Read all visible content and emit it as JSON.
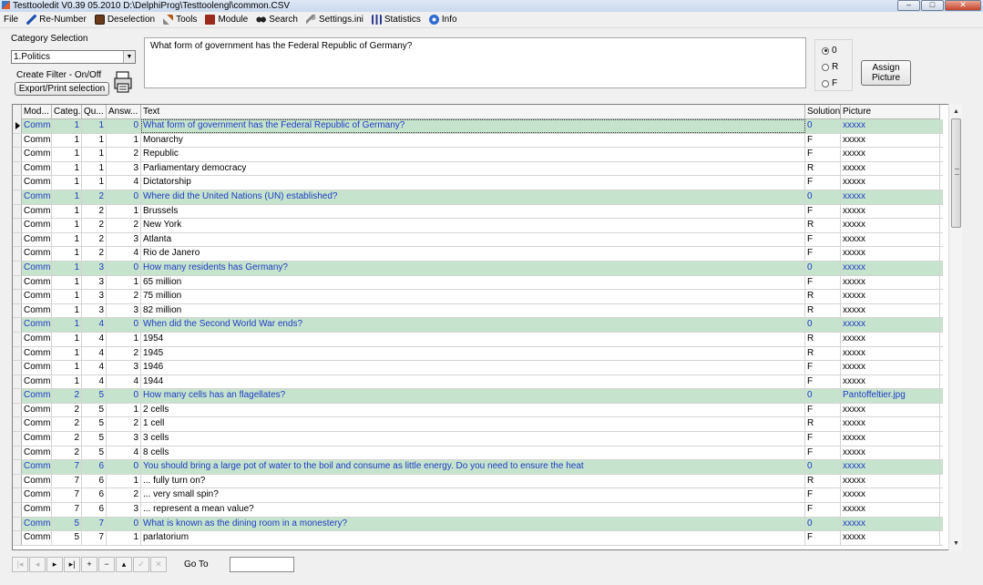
{
  "window": {
    "title": "Testtooledit V0.39 05.2010 D:\\DelphiProg\\Testtoolengl\\common.CSV"
  },
  "menu": [
    {
      "label": "File",
      "icon": "file-icon"
    },
    {
      "label": "Re-Number",
      "icon": "pen-icon"
    },
    {
      "label": "Deselection",
      "icon": "deselect-icon"
    },
    {
      "label": "Tools",
      "icon": "tools-icon"
    },
    {
      "label": "Module",
      "icon": "module-icon"
    },
    {
      "label": "Search",
      "icon": "binoculars-icon"
    },
    {
      "label": "Settings.ini",
      "icon": "settings-icon"
    },
    {
      "label": "Statistics",
      "icon": "statistics-icon"
    },
    {
      "label": "Info",
      "icon": "info-icon"
    }
  ],
  "controls": {
    "category_label": "Category Selection",
    "category_value": "1.Politics",
    "filter_label": "Create Filter - On/Off",
    "export_button": "Export/Print selection",
    "question_text": "What form of government has the Federal Republic of Germany?",
    "radios": [
      {
        "label": "0",
        "checked": true
      },
      {
        "label": "R",
        "checked": false
      },
      {
        "label": "F",
        "checked": false
      }
    ],
    "assign_button_line1": "Assign",
    "assign_button_line2": "Picture",
    "goto_label": "Go To"
  },
  "grid": {
    "columns": [
      "Mod...",
      "Categ.",
      "Qu...",
      "Answ...",
      "Text",
      "Solution",
      "Picture"
    ],
    "rows": [
      {
        "module": "Comm",
        "category": "1",
        "question": "1",
        "answer": "0",
        "text": "What form of government has the Federal Republic of Germany?",
        "solution": "0",
        "picture": "xxxxx"
      },
      {
        "module": "Comm",
        "category": "1",
        "question": "1",
        "answer": "1",
        "text": "Monarchy",
        "solution": "F",
        "picture": "xxxxx"
      },
      {
        "module": "Comm",
        "category": "1",
        "question": "1",
        "answer": "2",
        "text": "Republic",
        "solution": "F",
        "picture": "xxxxx"
      },
      {
        "module": "Comm",
        "category": "1",
        "question": "1",
        "answer": "3",
        "text": "Parliamentary democracy",
        "solution": "R",
        "picture": "xxxxx"
      },
      {
        "module": "Comm",
        "category": "1",
        "question": "1",
        "answer": "4",
        "text": "Dictatorship",
        "solution": "F",
        "picture": "xxxxx"
      },
      {
        "module": "Comm",
        "category": "1",
        "question": "2",
        "answer": "0",
        "text": "Where did the United Nations (UN) established?",
        "solution": "0",
        "picture": "xxxxx"
      },
      {
        "module": "Comm",
        "category": "1",
        "question": "2",
        "answer": "1",
        "text": "Brussels",
        "solution": "F",
        "picture": "xxxxx"
      },
      {
        "module": "Comm",
        "category": "1",
        "question": "2",
        "answer": "2",
        "text": "New York",
        "solution": "R",
        "picture": "xxxxx"
      },
      {
        "module": "Comm",
        "category": "1",
        "question": "2",
        "answer": "3",
        "text": "Atlanta",
        "solution": "F",
        "picture": "xxxxx"
      },
      {
        "module": "Comm",
        "category": "1",
        "question": "2",
        "answer": "4",
        "text": "Rio de Janero",
        "solution": "F",
        "picture": "xxxxx"
      },
      {
        "module": "Comm",
        "category": "1",
        "question": "3",
        "answer": "0",
        "text": "How many residents has Germany?",
        "solution": "0",
        "picture": "xxxxx"
      },
      {
        "module": "Comm",
        "category": "1",
        "question": "3",
        "answer": "1",
        "text": "65 million",
        "solution": "F",
        "picture": "xxxxx"
      },
      {
        "module": "Comm",
        "category": "1",
        "question": "3",
        "answer": "2",
        "text": "75 million",
        "solution": "R",
        "picture": "xxxxx"
      },
      {
        "module": "Comm",
        "category": "1",
        "question": "3",
        "answer": "3",
        "text": "82 million",
        "solution": "R",
        "picture": "xxxxx"
      },
      {
        "module": "Comm",
        "category": "1",
        "question": "4",
        "answer": "0",
        "text": "When did the Second World War ends?",
        "solution": "0",
        "picture": "xxxxx"
      },
      {
        "module": "Comm",
        "category": "1",
        "question": "4",
        "answer": "1",
        "text": "1954",
        "solution": "R",
        "picture": "xxxxx"
      },
      {
        "module": "Comm",
        "category": "1",
        "question": "4",
        "answer": "2",
        "text": "1945",
        "solution": "R",
        "picture": "xxxxx"
      },
      {
        "module": "Comm",
        "category": "1",
        "question": "4",
        "answer": "3",
        "text": "1946",
        "solution": "F",
        "picture": "xxxxx"
      },
      {
        "module": "Comm",
        "category": "1",
        "question": "4",
        "answer": "4",
        "text": "1944",
        "solution": "F",
        "picture": "xxxxx"
      },
      {
        "module": "Comm",
        "category": "2",
        "question": "5",
        "answer": "0",
        "text": "How many cells has an flagellates?",
        "solution": "0",
        "picture": "Pantoffeltier.jpg"
      },
      {
        "module": "Comm",
        "category": "2",
        "question": "5",
        "answer": "1",
        "text": "2 cells",
        "solution": "F",
        "picture": "xxxxx"
      },
      {
        "module": "Comm",
        "category": "2",
        "question": "5",
        "answer": "2",
        "text": "1 cell",
        "solution": "R",
        "picture": "xxxxx"
      },
      {
        "module": "Comm",
        "category": "2",
        "question": "5",
        "answer": "3",
        "text": "3 cells",
        "solution": "F",
        "picture": "xxxxx"
      },
      {
        "module": "Comm",
        "category": "2",
        "question": "5",
        "answer": "4",
        "text": "8 cells",
        "solution": "F",
        "picture": "xxxxx"
      },
      {
        "module": "Comm",
        "category": "7",
        "question": "6",
        "answer": "0",
        "text": "You should bring a large pot of water to the boil and consume as little energy. Do you need to ensure the heat",
        "solution": "0",
        "picture": "xxxxx"
      },
      {
        "module": "Comm",
        "category": "7",
        "question": "6",
        "answer": "1",
        "text": "... fully turn on?",
        "solution": "R",
        "picture": "xxxxx"
      },
      {
        "module": "Comm",
        "category": "7",
        "question": "6",
        "answer": "2",
        "text": "... very small spin?",
        "solution": "F",
        "picture": "xxxxx"
      },
      {
        "module": "Comm",
        "category": "7",
        "question": "6",
        "answer": "3",
        "text": "... represent a mean value?",
        "solution": "F",
        "picture": "xxxxx"
      },
      {
        "module": "Comm",
        "category": "5",
        "question": "7",
        "answer": "0",
        "text": "What is known as the dining room in a monestery?",
        "solution": "0",
        "picture": "xxxxx"
      },
      {
        "module": "Comm",
        "category": "5",
        "question": "7",
        "answer": "1",
        "text": "parlatorium",
        "solution": "F",
        "picture": "xxxxx"
      }
    ]
  },
  "navigator": [
    {
      "symbol": "|◂",
      "name": "first-record-button",
      "enabled": false
    },
    {
      "symbol": "◂",
      "name": "prior-record-button",
      "enabled": false
    },
    {
      "symbol": "▸",
      "name": "next-record-button",
      "enabled": true
    },
    {
      "symbol": "▸|",
      "name": "last-record-button",
      "enabled": true
    },
    {
      "symbol": "+",
      "name": "insert-record-button",
      "enabled": true
    },
    {
      "symbol": "−",
      "name": "delete-record-button",
      "enabled": true
    },
    {
      "symbol": "▴",
      "name": "edit-record-button",
      "enabled": true
    },
    {
      "symbol": "✓",
      "name": "post-record-button",
      "enabled": false
    },
    {
      "symbol": "✕",
      "name": "cancel-record-button",
      "enabled": false
    }
  ],
  "colors": {
    "question_row_bg": "#c6e4cd",
    "question_row_text": "#1f3bc5"
  }
}
